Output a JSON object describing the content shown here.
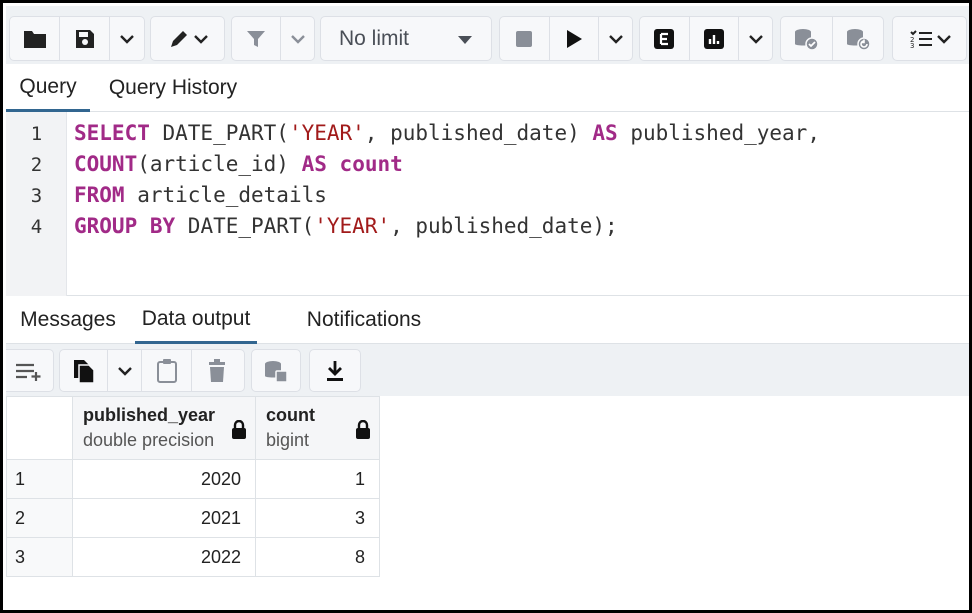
{
  "toolbar": {
    "icons": [
      "folder-open-icon",
      "save-icon",
      "chevron-down-icon",
      "pencil-icon",
      "chevron-down-icon",
      "filter-icon",
      "chevron-down-icon",
      "stop-icon",
      "play-icon",
      "chevron-down-icon",
      "explain-icon",
      "explain-analyze-icon",
      "chevron-down-icon",
      "commit-icon",
      "rollback-icon",
      "macros-icon"
    ],
    "limit_label": "No limit"
  },
  "editor_tabs": [
    "Query",
    "Query History"
  ],
  "editor": {
    "line_numbers": [
      "1",
      "2",
      "3",
      "4"
    ],
    "lines": [
      [
        {
          "t": "SELECT",
          "c": "kw"
        },
        {
          "t": " DATE_PART(",
          "c": ""
        },
        {
          "t": "'YEAR'",
          "c": "str"
        },
        {
          "t": ", published_date) ",
          "c": ""
        },
        {
          "t": "AS",
          "c": "kw"
        },
        {
          "t": " published_year,",
          "c": ""
        }
      ],
      [
        {
          "t": "COUNT",
          "c": "kw"
        },
        {
          "t": "(article_id) ",
          "c": ""
        },
        {
          "t": "AS",
          "c": "kw"
        },
        {
          "t": " ",
          "c": ""
        },
        {
          "t": "count",
          "c": "kw"
        }
      ],
      [
        {
          "t": "FROM",
          "c": "kw"
        },
        {
          "t": " article_details",
          "c": ""
        }
      ],
      [
        {
          "t": "GROUP BY",
          "c": "kw"
        },
        {
          "t": " DATE_PART(",
          "c": ""
        },
        {
          "t": "'YEAR'",
          "c": "str"
        },
        {
          "t": ", published_date);",
          "c": ""
        }
      ]
    ]
  },
  "result_tabs": [
    "Messages",
    "Data output",
    "Notifications"
  ],
  "data_toolbar": {
    "icons": [
      "add-row-icon",
      "copy-icon",
      "chevron-down-icon",
      "paste-icon",
      "delete-icon",
      "save-data-icon",
      "download-icon"
    ]
  },
  "grid": {
    "columns": [
      {
        "name": "published_year",
        "type": "double precision"
      },
      {
        "name": "count",
        "type": "bigint"
      }
    ],
    "rows": [
      {
        "num": "1",
        "published_year": "2020",
        "count": "1"
      },
      {
        "num": "2",
        "published_year": "2021",
        "count": "3"
      },
      {
        "num": "3",
        "published_year": "2022",
        "count": "8"
      }
    ]
  },
  "colors": {
    "keyword": "#a12a87",
    "string": "#a11a1a",
    "active_tab_underline": "#326690",
    "toolbar_bg": "#eef1f4"
  }
}
